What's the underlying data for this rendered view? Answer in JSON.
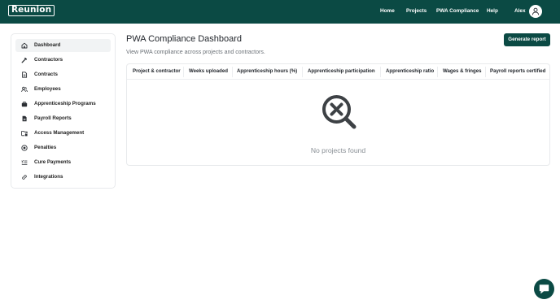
{
  "brand": {
    "name": "Reunion"
  },
  "nav": {
    "home": "Home",
    "projects": "Projects",
    "pwa_compliance": "PWA Compliance",
    "help": "Help",
    "user_name": "Alex"
  },
  "sidebar": {
    "items": [
      {
        "label": "Dashboard",
        "icon": "home-icon",
        "active": true
      },
      {
        "label": "Contractors",
        "icon": "hammer-icon"
      },
      {
        "label": "Contracts",
        "icon": "document-icon"
      },
      {
        "label": "Employees",
        "icon": "users-icon"
      },
      {
        "label": "Apprenticeship Programs",
        "icon": "toolbox-icon"
      },
      {
        "label": "Payroll Reports",
        "icon": "report-icon"
      },
      {
        "label": "Access Management",
        "icon": "folder-lock-icon"
      },
      {
        "label": "Penalties",
        "icon": "warning-circle-icon"
      },
      {
        "label": "Cure Payments",
        "icon": "list-check-icon"
      },
      {
        "label": "Integrations",
        "icon": "link-icon"
      }
    ]
  },
  "main": {
    "title": "PWA Compliance Dashboard",
    "subtitle": "View PWA compliance across projects and contractors.",
    "generate_button": "Generate report",
    "table": {
      "columns": [
        "Project & contractor",
        "Weeks uploaded",
        "Apprenticeship hours (%)",
        "Apprenticeship participation",
        "Apprenticeship ratio",
        "Wages & fringes",
        "Payroll reports certified"
      ],
      "rows": [],
      "empty_message": "No projects found"
    }
  },
  "colors": {
    "brand_primary": "#0b4a44",
    "sidebar_active_bg": "#f1f3f4",
    "border": "#e8eaec",
    "muted_text": "#6b7177",
    "empty_icon": "#3d4145"
  }
}
